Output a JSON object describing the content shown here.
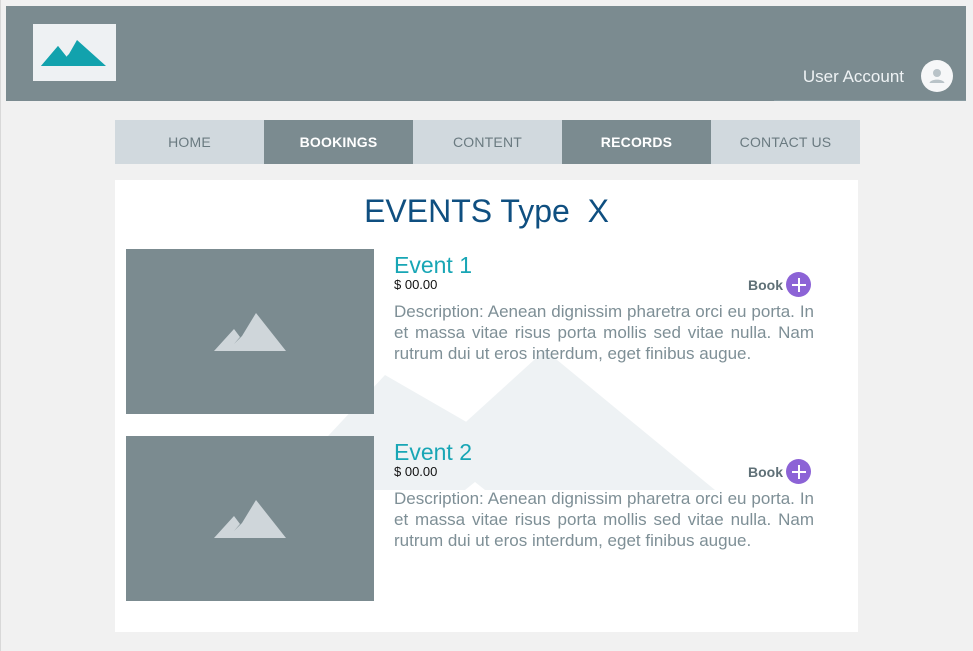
{
  "header": {
    "logo_icon": "mountain-logo-icon",
    "user_account_label": "User Account",
    "avatar_icon": "user-avatar-icon"
  },
  "nav": {
    "items": [
      {
        "label": "HOME",
        "active": false
      },
      {
        "label": "BOOKINGS",
        "active": true
      },
      {
        "label": "CONTENT",
        "active": false
      },
      {
        "label": "RECORDS",
        "active": true
      },
      {
        "label": "CONTACT US",
        "active": false
      }
    ]
  },
  "main": {
    "title": "EVENTS Type  X",
    "events": [
      {
        "title": "Event 1",
        "price": "$ 00.00",
        "book_label": "Book",
        "description": "Description: Aenean dignissim pharetra orci eu porta. In et massa vitae risus porta mollis sed vitae nulla. Nam rutrum dui ut eros interdum, eget finibus augue.",
        "image_icon": "image-placeholder-icon"
      },
      {
        "title": "Event 2",
        "price": "$ 00.00",
        "book_label": "Book",
        "description": "Description: Aenean dignissim pharetra orci eu porta. In et massa vitae risus porta mollis sed vitae nulla. Nam rutrum dui ut eros interdum, eget finibus augue.",
        "image_icon": "image-placeholder-icon"
      }
    ]
  },
  "colors": {
    "header_bg": "#7b8b90",
    "nav_light": "#d1d9de",
    "title_blue": "#0f4f80",
    "event_title_teal": "#18a6b5",
    "book_purple": "#8c63d6",
    "logo_teal": "#12a2ad"
  }
}
